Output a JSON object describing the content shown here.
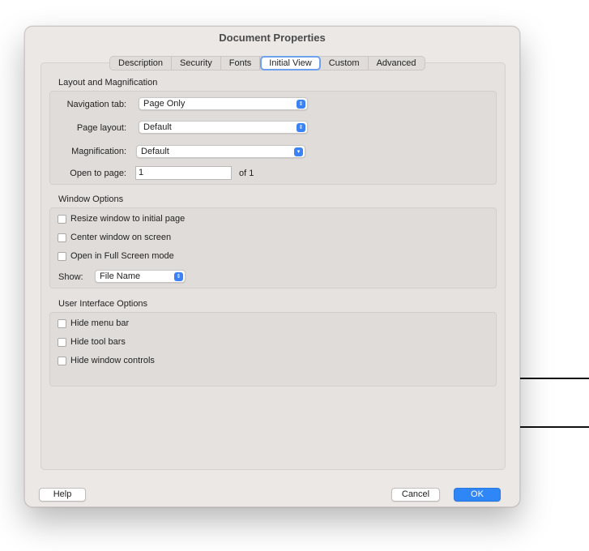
{
  "dialog": {
    "title": "Document Properties"
  },
  "tabs": [
    "Description",
    "Security",
    "Fonts",
    "Initial View",
    "Custom",
    "Advanced"
  ],
  "active_tab": "Initial View",
  "layout_section": {
    "label": "Layout and Magnification",
    "navigation_tab": {
      "label": "Navigation tab:",
      "value": "Page Only"
    },
    "page_layout": {
      "label": "Page layout:",
      "value": "Default"
    },
    "magnification": {
      "label": "Magnification:",
      "value": "Default"
    },
    "open_to_page": {
      "label": "Open to page:",
      "value": "1",
      "suffix": "of 1"
    }
  },
  "window_section": {
    "label": "Window Options",
    "resize": "Resize window to initial page",
    "center": "Center window on screen",
    "fullscreen": "Open in Full Screen mode",
    "show": {
      "label": "Show:",
      "value": "File Name"
    }
  },
  "ui_section": {
    "label": "User Interface Options",
    "hide_menu": "Hide menu bar",
    "hide_toolbars": "Hide tool bars",
    "hide_controls": "Hide window controls"
  },
  "buttons": {
    "help": "Help",
    "cancel": "Cancel",
    "ok": "OK"
  },
  "colors": {
    "accent": "#2f86f6",
    "focus_ring": "#6ea2ef",
    "dialog_bg": "#ece8e6"
  }
}
